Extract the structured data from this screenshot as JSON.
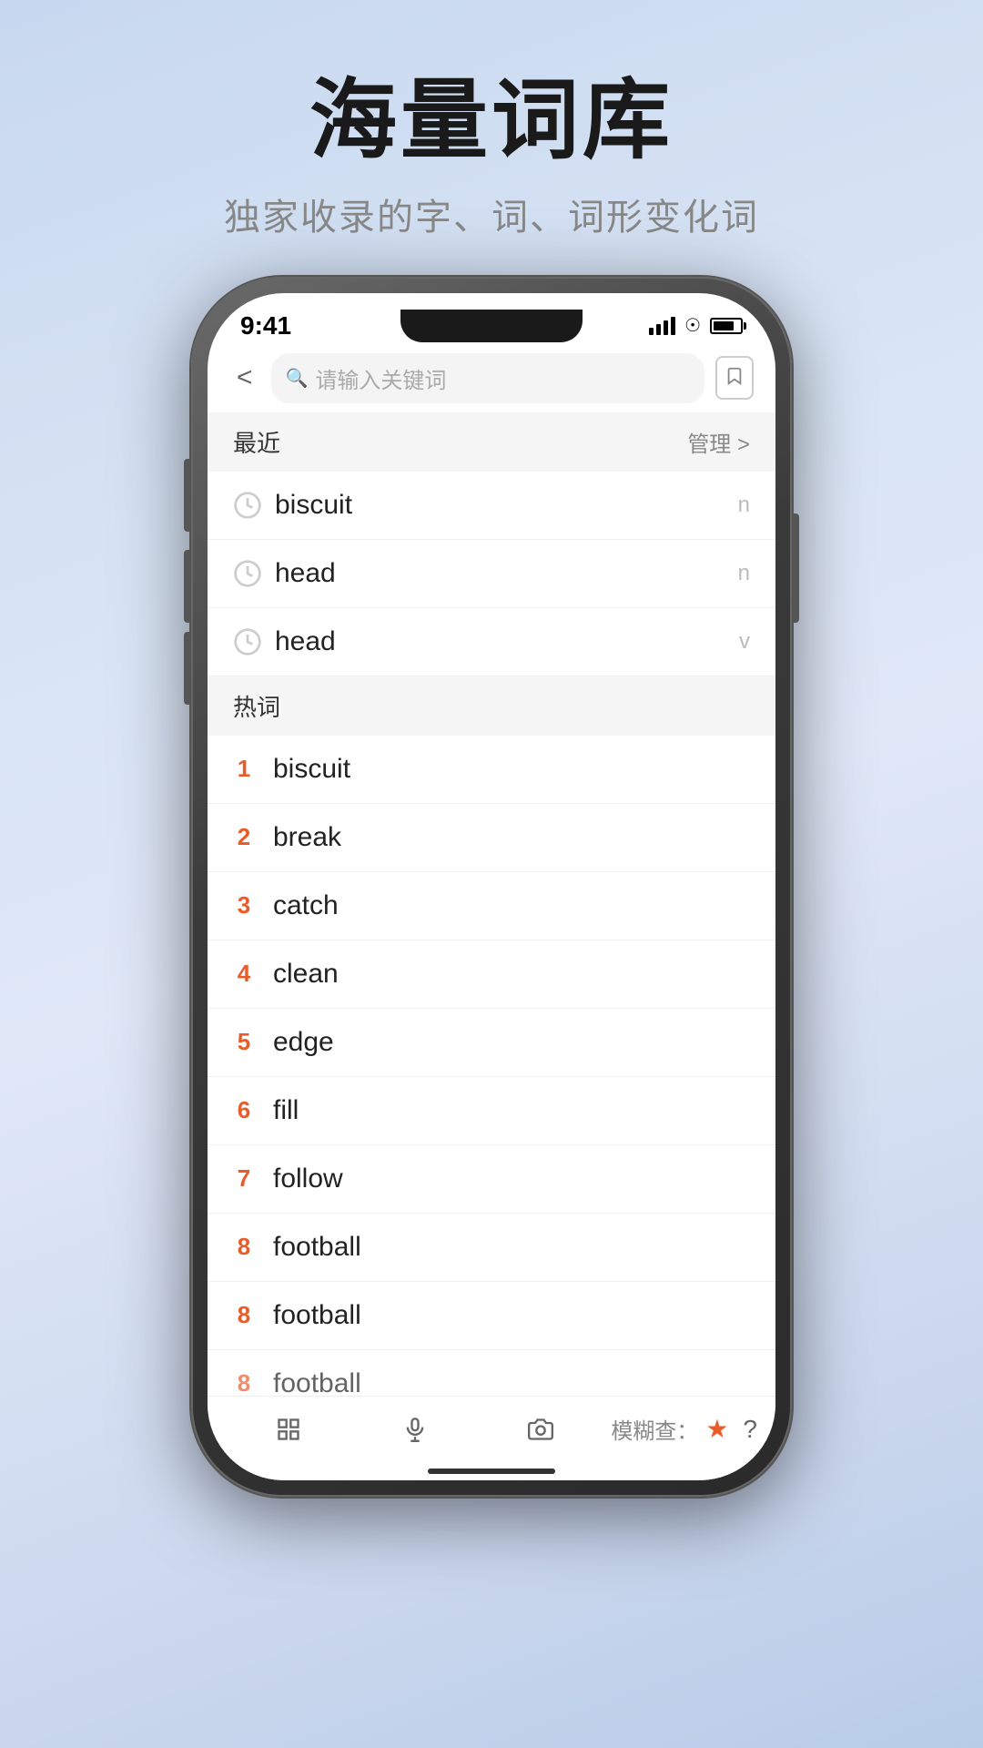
{
  "header": {
    "title": "海量词库",
    "subtitle": "独家收录的字、词、词形变化词"
  },
  "statusBar": {
    "time": "9:41",
    "batteryLabel": "battery"
  },
  "nav": {
    "searchPlaceholder": "请输入关键词",
    "backLabel": "<",
    "bookmarkLabel": "bookmark"
  },
  "recentSection": {
    "title": "最近",
    "manageLabel": "管理 >"
  },
  "recentItems": [
    {
      "word": "biscuit",
      "pos": "n"
    },
    {
      "word": "head",
      "pos": "n"
    },
    {
      "word": "head",
      "pos": "v"
    }
  ],
  "hotSection": {
    "title": "热词"
  },
  "hotItems": [
    {
      "rank": "1",
      "word": "biscuit"
    },
    {
      "rank": "2",
      "word": "break"
    },
    {
      "rank": "3",
      "word": "catch"
    },
    {
      "rank": "4",
      "word": "clean"
    },
    {
      "rank": "5",
      "word": "edge"
    },
    {
      "rank": "6",
      "word": "fill"
    },
    {
      "rank": "7",
      "word": "follow"
    },
    {
      "rank": "8",
      "word": "football"
    },
    {
      "rank": "8",
      "word": "football"
    },
    {
      "rank": "8",
      "word": "football"
    }
  ],
  "bottomBar": {
    "gridLabel": "grid",
    "micLabel": "mic",
    "cameraLabel": "camera",
    "fuzzyLabel": "模糊查：",
    "starLabel": "★",
    "questionLabel": "?"
  }
}
